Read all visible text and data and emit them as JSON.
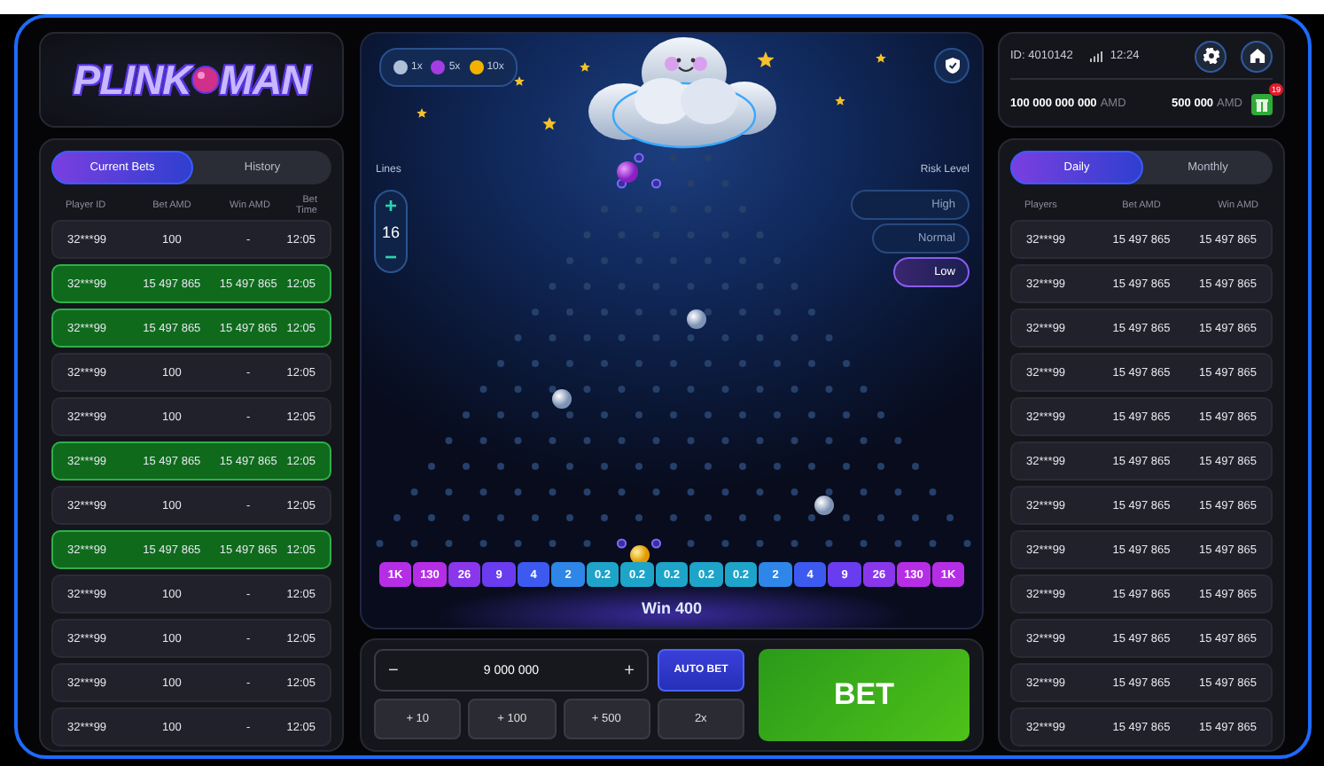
{
  "logo": {
    "left": "PLINK",
    "right": "MAN"
  },
  "bets_panel": {
    "tabs": [
      {
        "label": "Current Bets",
        "selected": true
      },
      {
        "label": "History",
        "selected": false
      }
    ],
    "columns": [
      "Player ID",
      "Bet AMD",
      "Win AMD",
      "Bet Time"
    ],
    "rows": [
      {
        "player": "32***99",
        "bet": "100",
        "win": "-",
        "time": "12:05",
        "won": false
      },
      {
        "player": "32***99",
        "bet": "15 497 865",
        "win": "15 497 865",
        "time": "12:05",
        "won": true
      },
      {
        "player": "32***99",
        "bet": "15 497 865",
        "win": "15 497 865",
        "time": "12:05",
        "won": true
      },
      {
        "player": "32***99",
        "bet": "100",
        "win": "-",
        "time": "12:05",
        "won": false
      },
      {
        "player": "32***99",
        "bet": "100",
        "win": "-",
        "time": "12:05",
        "won": false
      },
      {
        "player": "32***99",
        "bet": "15 497 865",
        "win": "15 497 865",
        "time": "12:05",
        "won": true
      },
      {
        "player": "32***99",
        "bet": "100",
        "win": "-",
        "time": "12:05",
        "won": false
      },
      {
        "player": "32***99",
        "bet": "15 497 865",
        "win": "15 497 865",
        "time": "12:05",
        "won": true
      },
      {
        "player": "32***99",
        "bet": "100",
        "win": "-",
        "time": "12:05",
        "won": false
      },
      {
        "player": "32***99",
        "bet": "100",
        "win": "-",
        "time": "12:05",
        "won": false
      },
      {
        "player": "32***99",
        "bet": "100",
        "win": "-",
        "time": "12:05",
        "won": false
      },
      {
        "player": "32***99",
        "bet": "100",
        "win": "-",
        "time": "12:05",
        "won": false
      }
    ]
  },
  "game": {
    "ball_legend": [
      {
        "label": "1x",
        "color": "#aebfd8"
      },
      {
        "label": "5x",
        "color": "#a43de2"
      },
      {
        "label": "10x",
        "color": "#f2b300"
      }
    ],
    "lines": {
      "label": "Lines",
      "plus": "+",
      "value": "16",
      "minus": "−"
    },
    "risk": {
      "label": "Risk Level",
      "options": [
        {
          "label": "High",
          "selected": false
        },
        {
          "label": "Normal",
          "selected": false
        },
        {
          "label": "Low",
          "selected": true
        }
      ]
    },
    "multipliers": [
      {
        "label": "1K",
        "color": "#b52ee6"
      },
      {
        "label": "130",
        "color": "#b52ee6"
      },
      {
        "label": "26",
        "color": "#8a37ec"
      },
      {
        "label": "9",
        "color": "#6a3cf0"
      },
      {
        "label": "4",
        "color": "#3d5af0"
      },
      {
        "label": "2",
        "color": "#2e86e8"
      },
      {
        "label": "0.2",
        "color": "#1ea4c9"
      },
      {
        "label": "0.2",
        "color": "#1ea4c9"
      },
      {
        "label": "0.2",
        "color": "#1ea4c9"
      },
      {
        "label": "0.2",
        "color": "#1ea4c9"
      },
      {
        "label": "0.2",
        "color": "#1ea4c9"
      },
      {
        "label": "2",
        "color": "#2e86e8"
      },
      {
        "label": "4",
        "color": "#3d5af0"
      },
      {
        "label": "9",
        "color": "#6a3cf0"
      },
      {
        "label": "26",
        "color": "#8a37ec"
      },
      {
        "label": "130",
        "color": "#b52ee6"
      },
      {
        "label": "1K",
        "color": "#b52ee6"
      }
    ],
    "win": "Win 400"
  },
  "bet_controls": {
    "minus": "−",
    "amount": "9 000 000",
    "plus": "+",
    "auto_bet": "AUTO BET",
    "bet": "BET",
    "quick": [
      "+ 10",
      "+ 100",
      "+ 500",
      "2x"
    ]
  },
  "account": {
    "id": "ID: 4010142",
    "time": "12:24",
    "balance": "100 000 000 000",
    "balance_currency": "AMD",
    "bonus": "500 000",
    "bonus_currency": "AMD",
    "gift_badge": "19"
  },
  "leaders_panel": {
    "tabs": [
      {
        "label": "Daily",
        "selected": true
      },
      {
        "label": "Monthly",
        "selected": false
      }
    ],
    "columns": [
      "Players",
      "Bet AMD",
      "Win AMD"
    ],
    "rows": [
      {
        "player": "32***99",
        "bet": "15 497 865",
        "win": "15 497 865"
      },
      {
        "player": "32***99",
        "bet": "15 497 865",
        "win": "15 497 865"
      },
      {
        "player": "32***99",
        "bet": "15 497 865",
        "win": "15 497 865"
      },
      {
        "player": "32***99",
        "bet": "15 497 865",
        "win": "15 497 865"
      },
      {
        "player": "32***99",
        "bet": "15 497 865",
        "win": "15 497 865"
      },
      {
        "player": "32***99",
        "bet": "15 497 865",
        "win": "15 497 865"
      },
      {
        "player": "32***99",
        "bet": "15 497 865",
        "win": "15 497 865"
      },
      {
        "player": "32***99",
        "bet": "15 497 865",
        "win": "15 497 865"
      },
      {
        "player": "32***99",
        "bet": "15 497 865",
        "win": "15 497 865"
      },
      {
        "player": "32***99",
        "bet": "15 497 865",
        "win": "15 497 865"
      },
      {
        "player": "32***99",
        "bet": "15 497 865",
        "win": "15 497 865"
      },
      {
        "player": "32***99",
        "bet": "15 497 865",
        "win": "15 497 865"
      }
    ]
  }
}
